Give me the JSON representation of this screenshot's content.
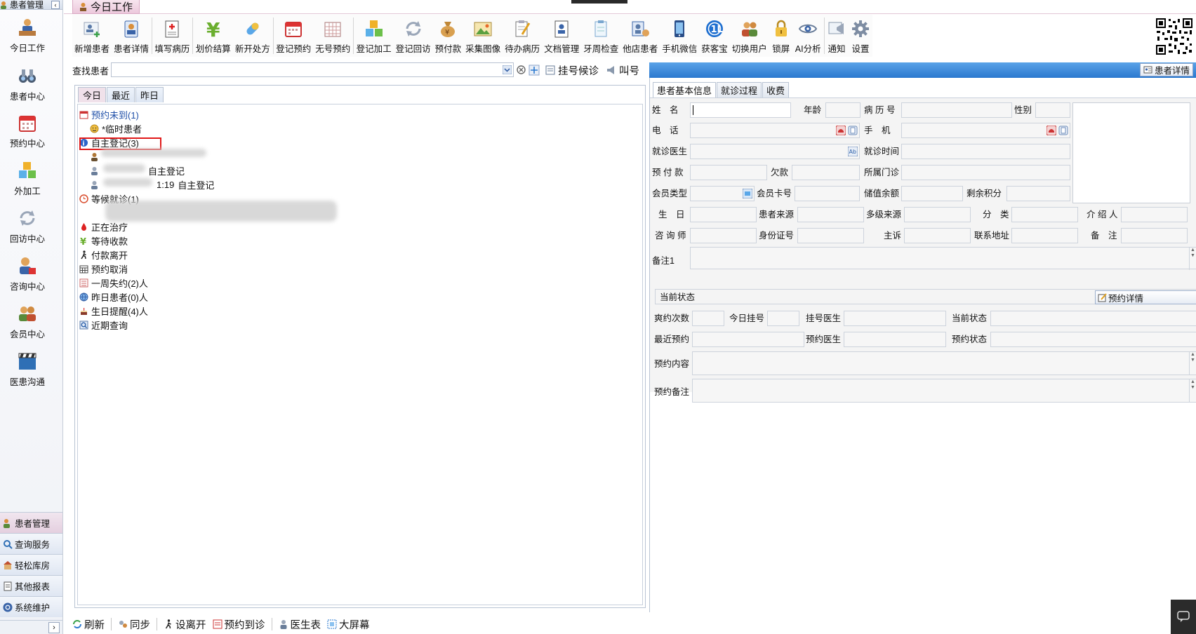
{
  "sidebar": {
    "header": "患者管理",
    "pin": "‹",
    "nav": [
      {
        "label": "今日工作",
        "icon": "doctor-desk-icon"
      },
      {
        "label": "患者中心",
        "icon": "binoculars-icon"
      },
      {
        "label": "预约中心",
        "icon": "calendar-icon"
      },
      {
        "label": "外加工",
        "icon": "cubes-icon"
      },
      {
        "label": "回访中心",
        "icon": "refresh-icon"
      },
      {
        "label": "咨询中心",
        "icon": "consult-icon"
      },
      {
        "label": "会员中心",
        "icon": "members-icon"
      },
      {
        "label": "医患沟通",
        "icon": "clapper-icon"
      }
    ],
    "modules": [
      "患者管理",
      "查询服务",
      "轻松库房",
      "其他报表",
      "系统维护"
    ],
    "collapse_arrow": "›"
  },
  "window": {
    "tab_title": "今日工作"
  },
  "toolbar": {
    "items": [
      "新增患者",
      "患者详情",
      "填写病历",
      "划价结算",
      "新开处方",
      "登记预约",
      "无号预约",
      "登记加工",
      "登记回访",
      "预付款",
      "采集图像",
      "待办病历",
      "文档管理",
      "牙周检查",
      "他店患者",
      "手机微信",
      "获客宝",
      "切换用户",
      "锁屏",
      "AI分析",
      "通知",
      "设置"
    ]
  },
  "search": {
    "label": "查找患者",
    "value": "",
    "btn_register": "挂号候诊",
    "btn_call": "叫号"
  },
  "left_tabs": [
    "今日",
    "最近",
    "昨日"
  ],
  "tree": {
    "appt_missed": "预约未到(1)",
    "temp_patient": "*临时患者",
    "self_reg": "自主登记(3)",
    "self_reg_child1_tail": "自主登记",
    "self_reg_child2_time": "1:19",
    "self_reg_child2_tail": "自主登记",
    "waiting": "等候就诊(1)",
    "treating": "正在治疗",
    "await_pay": "等待收款",
    "paid_left": "付款离开",
    "appt_cancel": "预约取消",
    "week_missed": "一周失约(2)人",
    "yesterday": "昨日患者(0)人",
    "birthday": "生日提醒(4)人",
    "recent_query": "近期查询"
  },
  "right": {
    "header_btn": "患者详情",
    "tabs": [
      "患者基本信息",
      "就诊过程",
      "收费"
    ],
    "labels": {
      "name": "姓　名",
      "age": "年龄",
      "record_no": "病 历 号",
      "gender": "性别",
      "phone": "电　话",
      "mobile": "手　机",
      "doctor": "就诊医生",
      "visit_time": "就诊时间",
      "prepay": "预 付 款",
      "owed": "欠款",
      "clinic": "所属门诊",
      "member_type": "会员类型",
      "member_card": "会员卡号",
      "balance": "储值余额",
      "points": "剩余积分",
      "birthday": "生　日",
      "source": "患者来源",
      "multi_source": "多级来源",
      "category": "分　类",
      "referrer": "介 绍 人",
      "consultant": "咨 询 师",
      "id_no": "身份证号",
      "complaint": "主诉",
      "address": "联系地址",
      "remark": "备　注",
      "remark1": "备注1"
    },
    "status_section": "当前状态",
    "status_btn": "预约详情",
    "status_labels": {
      "missed_count": "爽约次数",
      "today_reg": "今日挂号",
      "reg_doctor": "挂号医生",
      "current_status": "当前状态",
      "last_appt": "最近预约",
      "appt_doctor": "预约医生",
      "appt_status": "预约状态",
      "appt_content": "预约内容",
      "appt_remark": "预约备注"
    }
  },
  "bottombar": [
    "刷新",
    "同步",
    "设离开",
    "预约到诊",
    "医生表",
    "大屏幕"
  ],
  "colors": {
    "accent": "#2b78cf",
    "highlight": "#e01818",
    "tab_active": "#f0e1ea"
  }
}
